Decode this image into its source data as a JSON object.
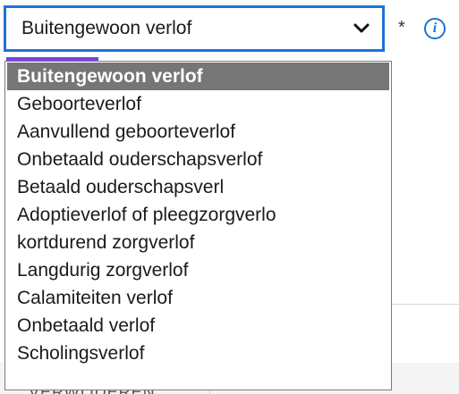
{
  "select": {
    "value": "Buitengewoon verlof",
    "required_mark": "*",
    "info_glyph": "i"
  },
  "options": [
    "Buitengewoon verlof",
    "Geboorteverlof",
    "Aanvullend geboorteverlof",
    "Onbetaald ouderschapsverlof",
    "Betaald ouderschapsverl",
    "Adoptieverlof of pleegzorgverlo",
    "kortdurend zorgverlof",
    "Langdurig zorgverlof",
    "Calamiteiten verlof",
    "Onbetaald verlof",
    "Scholingsverlof"
  ],
  "selected_index": 0,
  "background": {
    "partial_text": "VERWIJDEREN"
  },
  "colors": {
    "focus_border": "#1e73d6",
    "selected_option_bg": "#767676",
    "focus_underline": "#7b3fe4",
    "info_icon": "#1e73d6"
  },
  "icons": {
    "dropdown": "chevron-down-icon",
    "info": "info-icon"
  }
}
